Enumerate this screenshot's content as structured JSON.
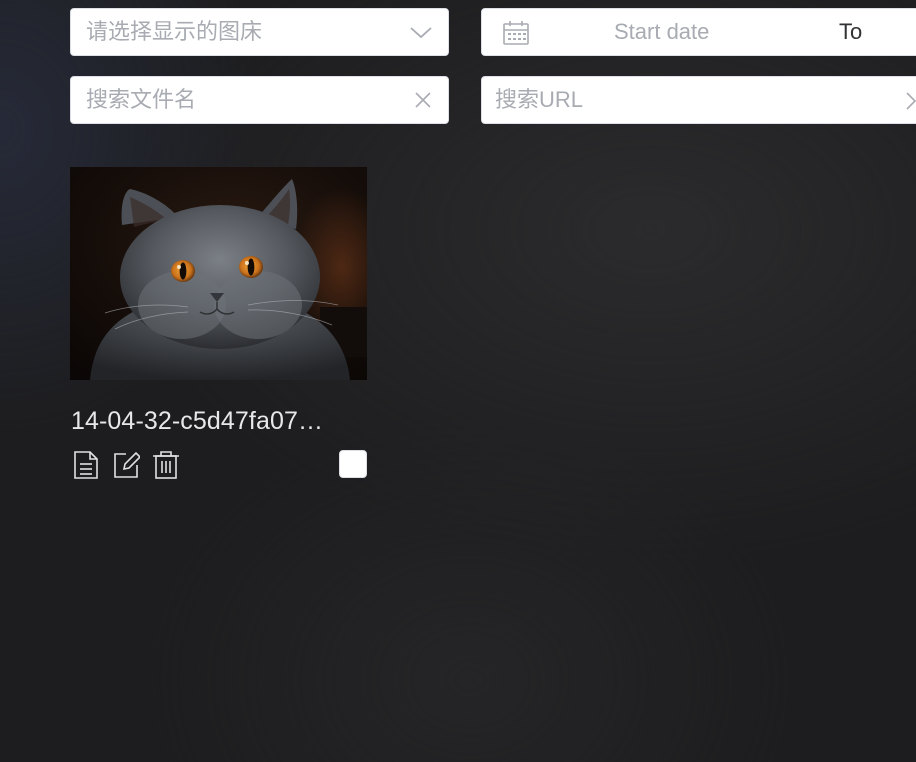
{
  "filters": {
    "gallery_select": {
      "placeholder": "请选择显示的图床",
      "icon": "chevron-down-icon"
    },
    "date_range": {
      "start_placeholder": "Start date",
      "separator": "To",
      "icon": "calendar-icon"
    },
    "filename_search": {
      "placeholder": "搜索文件名",
      "icon": "close-icon"
    },
    "url_search": {
      "placeholder": "搜索URL",
      "icon": "chevron-right-icon"
    }
  },
  "images": [
    {
      "filename": "14-04-32-c5d47fa07…",
      "thumbnail": "grey-cat-photo",
      "actions": [
        "document-icon",
        "edit-icon",
        "trash-icon"
      ],
      "selected": false
    }
  ],
  "colors": {
    "background": "#1d1d1f",
    "field_background": "#ffffff",
    "placeholder_text": "#a8abb2",
    "filename_text": "#e8e8ea"
  }
}
